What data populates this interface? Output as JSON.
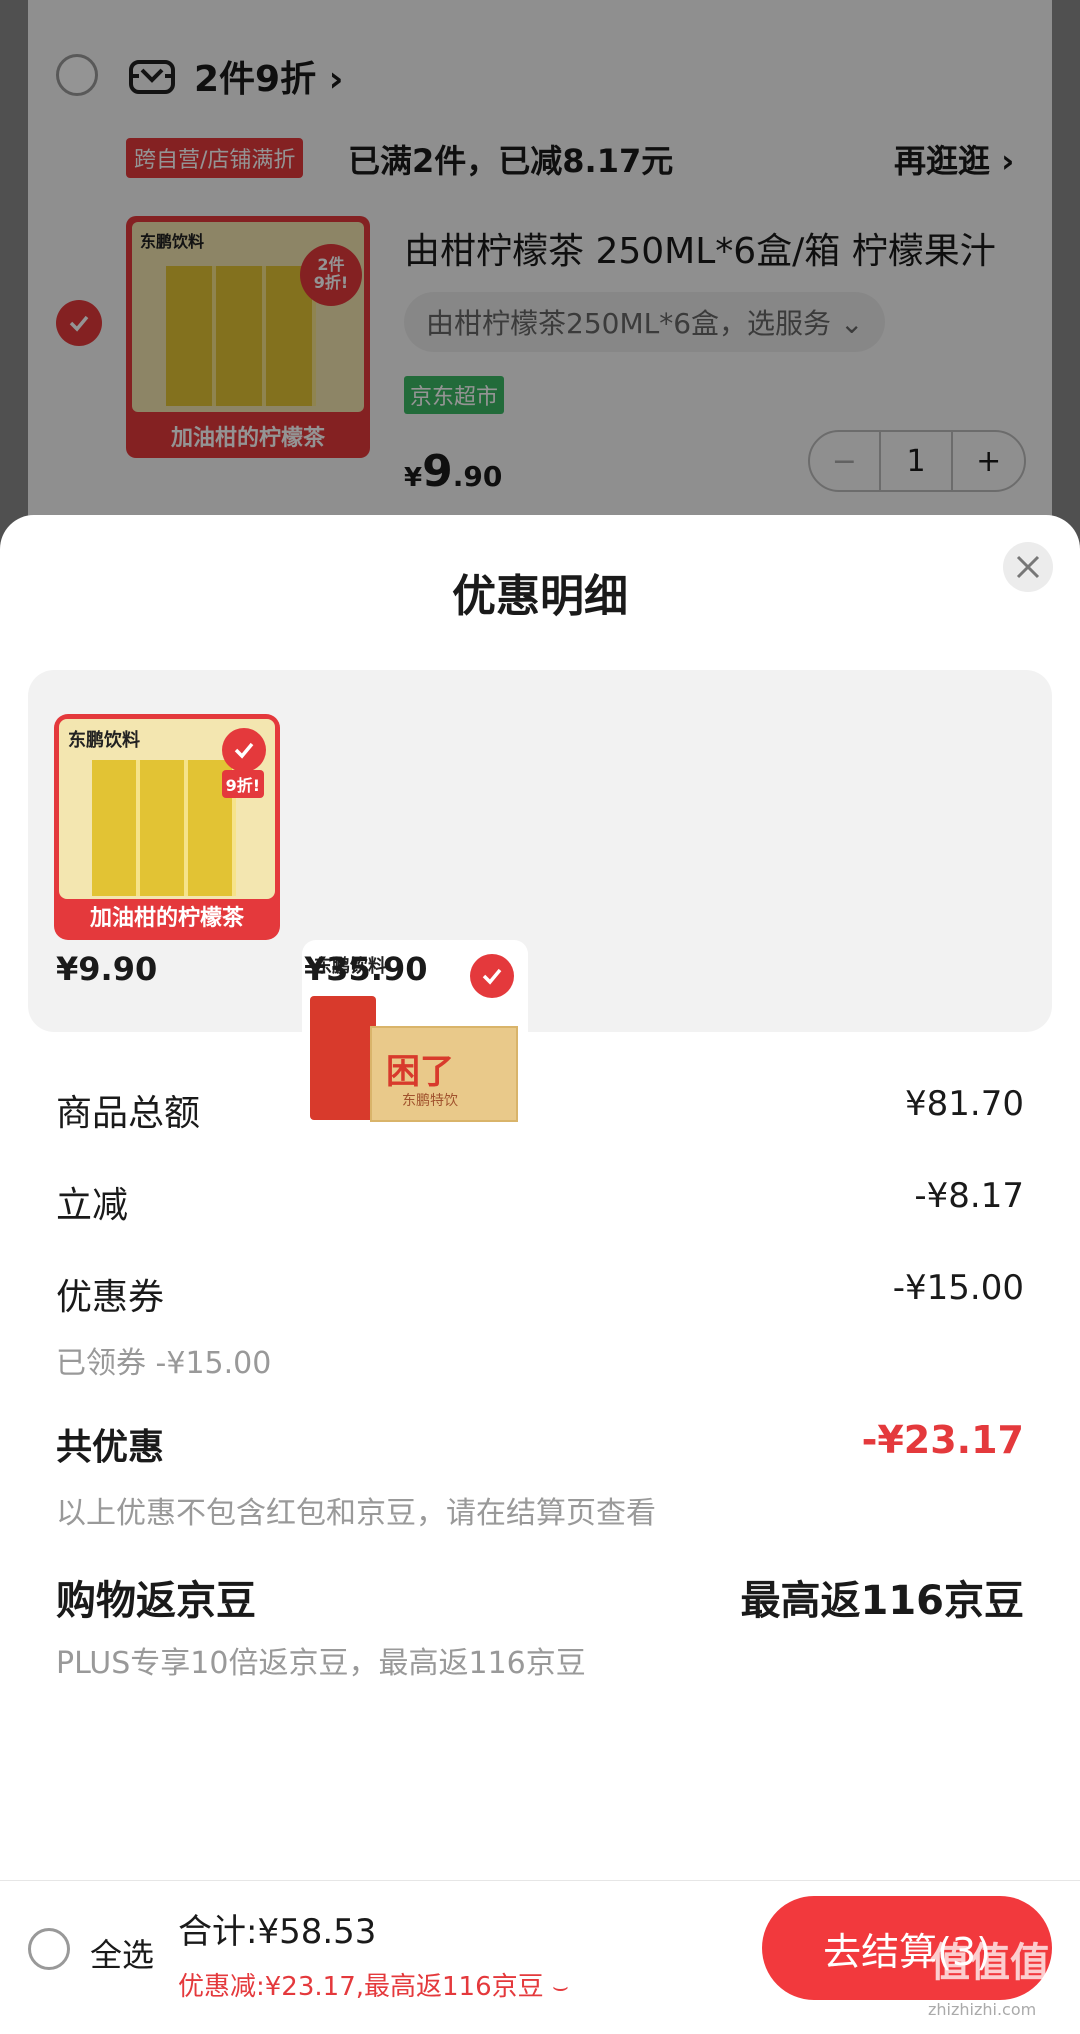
{
  "cart": {
    "promo_title": "2件9折",
    "promo_chevron": "›",
    "promo_tag": "跨自营/店铺满折",
    "promo_status": "已满2件，已减8.17元",
    "shop_more": "再逛逛",
    "shop_more_chevron": "›",
    "item": {
      "title": "由柑柠檬茶 250ML*6盒/箱 柠檬果汁",
      "service_select": "由柑柠檬茶250ML*6盒，选服务",
      "store_badge": "京东超市",
      "price_symbol": "¥",
      "price_int": "9",
      "price_dec": ".90",
      "image_brand": "东鹏饮料",
      "image_badge_line1": "2件",
      "image_badge_line2": "9折!",
      "image_slogan": "加油柑的柠檬茶",
      "quantity": "1",
      "minus": "−",
      "plus": "+"
    }
  },
  "sheet": {
    "title": "优惠明细",
    "close": "×",
    "products": [
      {
        "price": "¥9.90",
        "brand": "东鹏饮料",
        "badge": "9折!",
        "slogan": "加油柑的柠檬茶"
      },
      {
        "price": "¥35.90",
        "brand": "东鹏饮料",
        "box_text": "困了",
        "box_brand": "东鹏特饮"
      }
    ],
    "rows": {
      "subtotal_label": "商品总额",
      "subtotal_value": "¥81.70",
      "instant_label": "立减",
      "instant_value": "-¥8.17",
      "coupon_label": "优惠券",
      "coupon_value": "-¥15.00",
      "coupon_sub": "已领券 -¥15.00",
      "total_label": "共优惠",
      "total_value": "-¥23.17",
      "total_sub": "以上优惠不包含红包和京豆，请在结算页查看",
      "beans_label": "购物返京豆",
      "beans_value": "最高返116京豆",
      "beans_sub": "PLUS专享10倍返京豆，最高返116京豆"
    }
  },
  "footer": {
    "select_all": "全选",
    "total": "合计:¥58.53",
    "discount": "优惠减:¥23.17,最高返116京豆",
    "discount_chevron": "⌣",
    "checkout": "去结算(3)",
    "watermark": "值值值",
    "watermark_url": "zhizhizhi.com"
  },
  "colors": {
    "accent": "#e4393c",
    "green": "#3bb864",
    "muted": "#999999"
  }
}
